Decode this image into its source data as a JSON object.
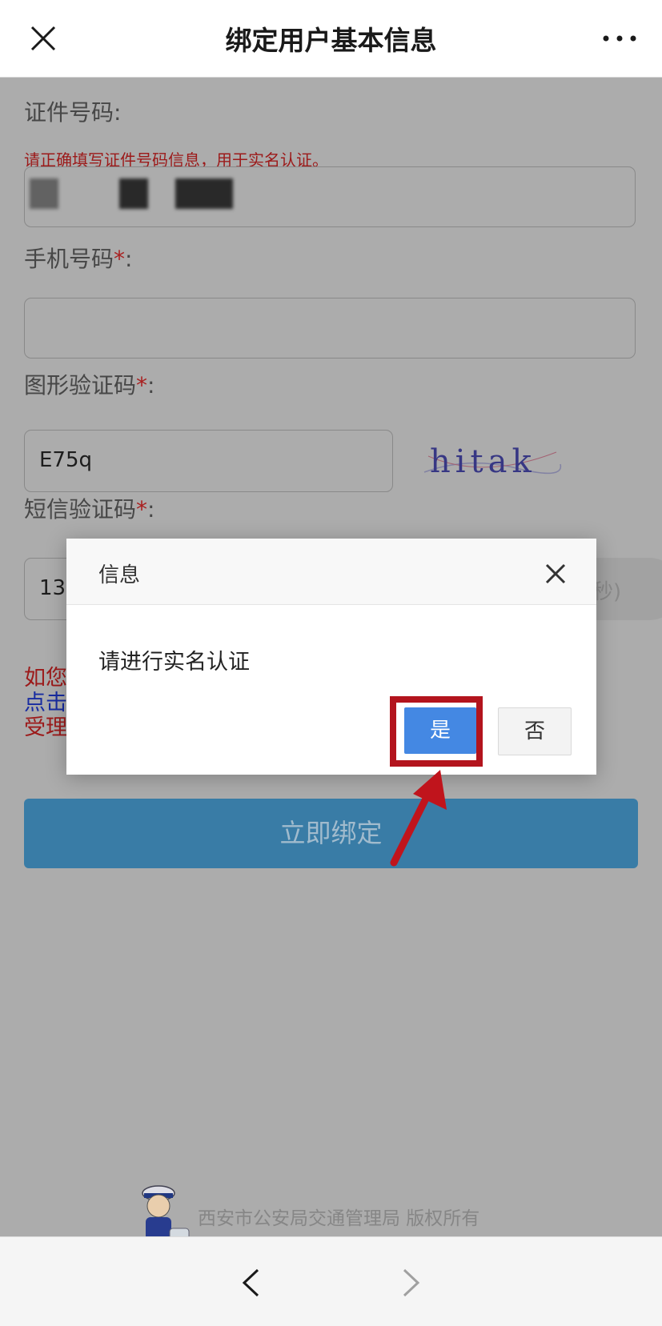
{
  "titlebar": {
    "title": "绑定用户基本信息"
  },
  "form": {
    "id_label": "证件号码:",
    "id_hint": "请正确填写证件号码信息，用于实名认证。",
    "phone_label": "手机号码",
    "captcha_label": "图形验证码",
    "captcha_value": "E75q",
    "captcha_image_text": "hitak",
    "sms_label": "短信验证码",
    "sms_value": "13",
    "sms_button_text": "秒)",
    "required_mark": "*",
    "colon": ":"
  },
  "notice": {
    "line1": "如您",
    "line2": "点击",
    "line3": "受理"
  },
  "bind_button": "立即绑定",
  "footer": {
    "text": "西安市公安局交通管理局  版权所有"
  },
  "dialog": {
    "title": "信息",
    "message": "请进行实名认证",
    "yes": "是",
    "no": "否"
  },
  "colors": {
    "highlight": "#b3141d",
    "primary": "#4488e3",
    "bind_button": "#3c82ad",
    "hint_red": "#a31c1c"
  }
}
